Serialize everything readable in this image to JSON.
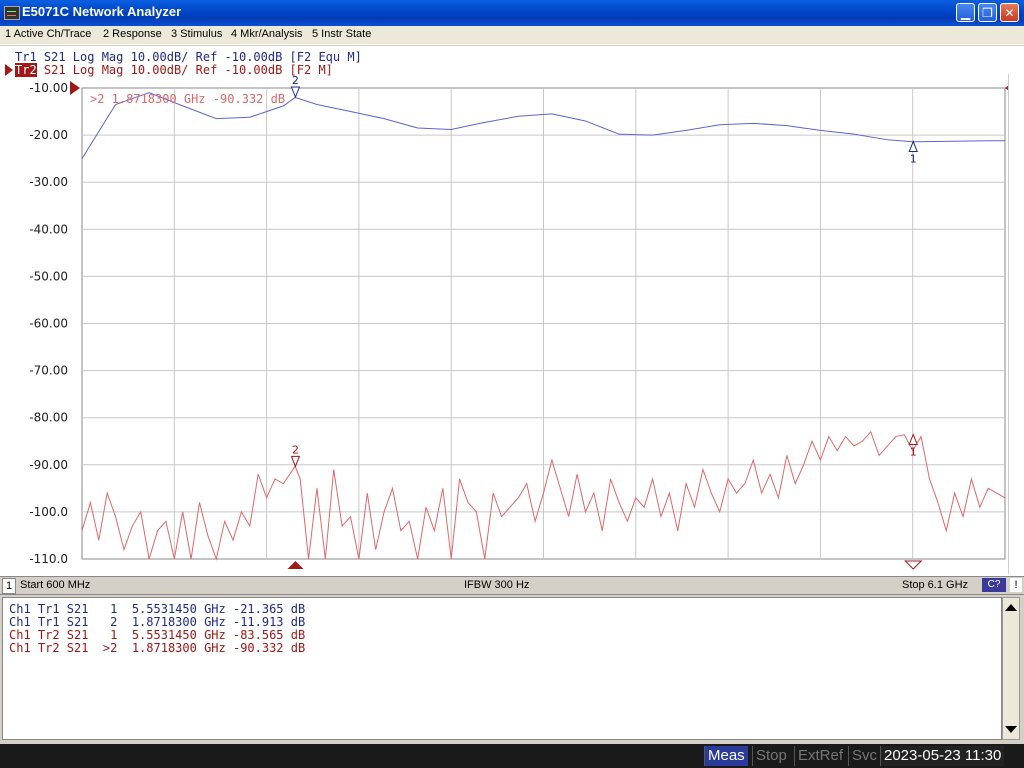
{
  "window": {
    "title": "E5071C Network Analyzer"
  },
  "menu": [
    "1 Active Ch/Trace",
    "2 Response",
    "3 Stimulus",
    "4 Mkr/Analysis",
    "5 Instr State"
  ],
  "traces": {
    "tr1": {
      "label": "Tr1",
      "text": " S21 Log Mag 10.00dB/ Ref -10.00dB [F2 Equ M]",
      "color": "#5a64d8"
    },
    "tr2": {
      "label": "Tr2",
      "text": " S21 Log Mag 10.00dB/ Ref -10.00dB [F2 M]",
      "color": "#e06868"
    }
  },
  "active_marker_readout": ">2  1.8718300 GHz -90.332 dB",
  "status": {
    "channel": "1",
    "start": "Start 600 MHz",
    "ifbw": "IFBW 300 Hz",
    "stop": "Stop 6.1 GHz",
    "cal": "C?",
    "warn": "!"
  },
  "marker_table": [
    "Ch1 Tr1 S21   1  5.5531450 GHz -21.365 dB",
    "Ch1 Tr1 S21   2  1.8718300 GHz -11.913 dB",
    "Ch1 Tr2 S21   1  5.5531450 GHz -83.565 dB",
    "Ch1 Tr2 S21  >2  1.8718300 GHz -90.332 dB"
  ],
  "statusbar": {
    "meas": "Meas",
    "stop": "Stop",
    "extref": "ExtRef",
    "svc": "Svc",
    "time": "2023-05-23 11:30"
  },
  "chart_data": {
    "type": "line",
    "x_unit": "GHz",
    "xlim": [
      0.6,
      6.1
    ],
    "ylim": [
      -110,
      -10
    ],
    "y_ticks": [
      "-10.00",
      "-20.00",
      "-30.00",
      "-40.00",
      "-50.00",
      "-60.00",
      "-70.00",
      "-80.00",
      "-90.00",
      "-100.0",
      "-110.0"
    ],
    "grid": true,
    "series": [
      {
        "name": "Tr1",
        "x": [
          0.6,
          0.8,
          1.0,
          1.2,
          1.4,
          1.6,
          1.8,
          1.87,
          2.0,
          2.2,
          2.4,
          2.6,
          2.8,
          3.0,
          3.2,
          3.4,
          3.6,
          3.8,
          4.0,
          4.2,
          4.4,
          4.6,
          4.8,
          5.0,
          5.2,
          5.4,
          5.55,
          5.8,
          6.0,
          6.1
        ],
        "y": [
          -25.0,
          -13.5,
          -11.0,
          -13.8,
          -16.5,
          -16.2,
          -13.8,
          -12.0,
          -13.5,
          -15.0,
          -16.5,
          -18.5,
          -18.8,
          -17.3,
          -16.0,
          -15.5,
          -17.0,
          -19.8,
          -20.0,
          -19.0,
          -17.8,
          -17.5,
          -18.0,
          -19.0,
          -19.8,
          -21.0,
          -21.4,
          -21.3,
          -21.2,
          -21.2
        ]
      },
      {
        "name": "Tr2",
        "x": [
          0.6,
          0.65,
          0.7,
          0.75,
          0.8,
          0.85,
          0.9,
          0.95,
          1.0,
          1.05,
          1.1,
          1.15,
          1.2,
          1.25,
          1.3,
          1.35,
          1.4,
          1.45,
          1.5,
          1.55,
          1.6,
          1.65,
          1.7,
          1.75,
          1.8,
          1.87,
          1.9,
          1.95,
          2.0,
          2.05,
          2.1,
          2.15,
          2.2,
          2.25,
          2.3,
          2.35,
          2.4,
          2.45,
          2.5,
          2.55,
          2.6,
          2.65,
          2.7,
          2.75,
          2.8,
          2.85,
          2.9,
          2.95,
          3.0,
          3.05,
          3.1,
          3.15,
          3.2,
          3.25,
          3.3,
          3.35,
          3.4,
          3.45,
          3.5,
          3.55,
          3.6,
          3.65,
          3.7,
          3.75,
          3.8,
          3.85,
          3.9,
          3.95,
          4.0,
          4.05,
          4.1,
          4.15,
          4.2,
          4.25,
          4.3,
          4.35,
          4.4,
          4.45,
          4.5,
          4.55,
          4.6,
          4.65,
          4.7,
          4.75,
          4.8,
          4.85,
          4.9,
          4.95,
          5.0,
          5.05,
          5.1,
          5.15,
          5.2,
          5.25,
          5.3,
          5.35,
          5.4,
          5.45,
          5.5,
          5.55,
          5.6,
          5.65,
          5.7,
          5.75,
          5.8,
          5.85,
          5.9,
          5.95,
          6.0,
          6.05,
          6.1
        ],
        "y": [
          -104,
          -98,
          -106,
          -96,
          -101,
          -108,
          -103,
          -100,
          -110,
          -104,
          -102,
          -110,
          -100,
          -110,
          -98,
          -105,
          -110,
          -102,
          -106,
          -100,
          -103,
          -92,
          -97,
          -93,
          -94,
          -90.3,
          -93,
          -110,
          -95,
          -110,
          -91,
          -103,
          -101,
          -110,
          -96,
          -108,
          -100,
          -95,
          -104,
          -102,
          -110,
          -99,
          -104,
          -95,
          -110,
          -93,
          -98,
          -100,
          -110,
          -96,
          -101,
          -99,
          -97,
          -94,
          -102,
          -96,
          -89,
          -95,
          -101,
          -92,
          -100,
          -96,
          -104,
          -93,
          -98,
          -102,
          -97,
          -99,
          -93,
          -101,
          -96,
          -104,
          -94,
          -99,
          -91,
          -96,
          -100,
          -93,
          -96,
          -94,
          -89,
          -96,
          -92,
          -97,
          -88,
          -94,
          -90,
          -85,
          -89,
          -84,
          -87,
          -84,
          -86,
          -85,
          -83,
          -88,
          -86,
          -84.0,
          -83.6,
          -87,
          -84,
          -93,
          -98,
          -104,
          -96,
          -101,
          -93,
          -99,
          -95,
          -96,
          -97
        ]
      }
    ],
    "markers": [
      {
        "trace": "Tr1",
        "id": "1",
        "x": 5.553145,
        "y": -21.365
      },
      {
        "trace": "Tr1",
        "id": "2",
        "x": 1.87183,
        "y": -11.913
      },
      {
        "trace": "Tr2",
        "id": "1",
        "x": 5.553145,
        "y": -83.565
      },
      {
        "trace": "Tr2",
        "id": "2",
        "x": 1.87183,
        "y": -90.332
      }
    ]
  }
}
